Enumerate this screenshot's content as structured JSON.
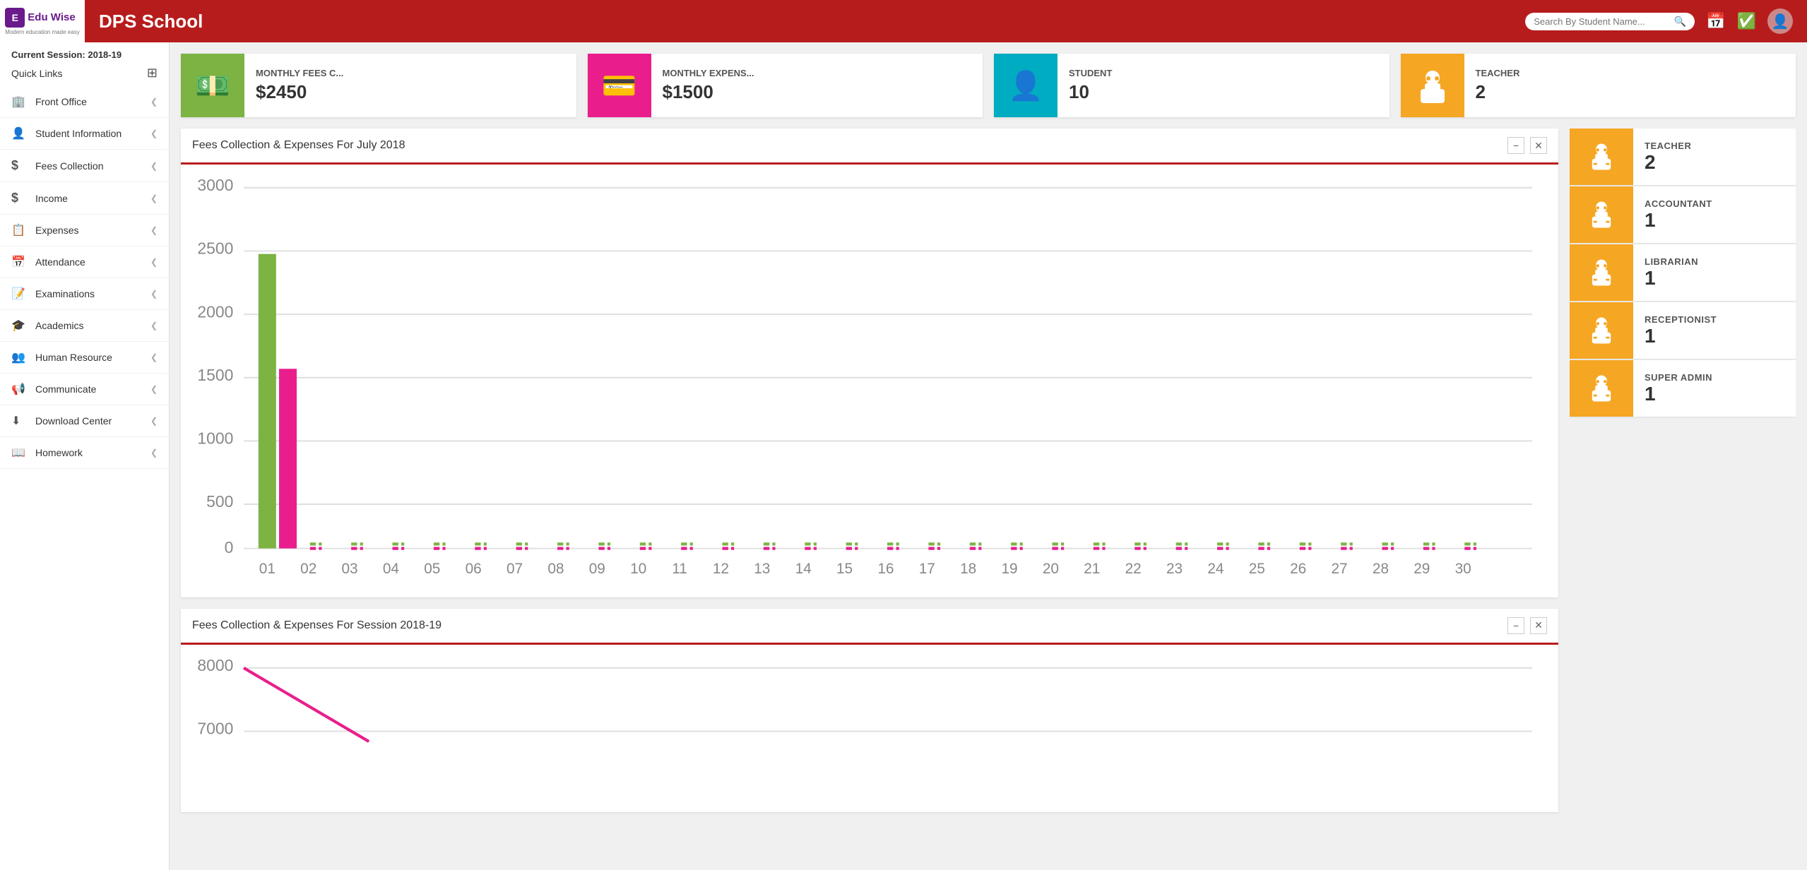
{
  "header": {
    "school_name": "DPS School",
    "search_placeholder": "Search By Student Name...",
    "logo_line1": "Edu Wise",
    "logo_line2": "Modern education made easy"
  },
  "sidebar": {
    "session": "Current Session: 2018-19",
    "quick_links_label": "Quick Links",
    "nav_items": [
      {
        "id": "front-office",
        "icon": "🏢",
        "label": "Front Office"
      },
      {
        "id": "student-information",
        "icon": "👤",
        "label": "Student Information"
      },
      {
        "id": "fees-collection",
        "icon": "$",
        "label": "Fees Collection"
      },
      {
        "id": "income",
        "icon": "$",
        "label": "Income"
      },
      {
        "id": "expenses",
        "icon": "📋",
        "label": "Expenses"
      },
      {
        "id": "attendance",
        "icon": "📅",
        "label": "Attendance"
      },
      {
        "id": "examinations",
        "icon": "📝",
        "label": "Examinations"
      },
      {
        "id": "academics",
        "icon": "🎓",
        "label": "Academics"
      },
      {
        "id": "human-resource",
        "icon": "👥",
        "label": "Human Resource"
      },
      {
        "id": "communicate",
        "icon": "📢",
        "label": "Communicate"
      },
      {
        "id": "download-center",
        "icon": "⬇",
        "label": "Download Center"
      },
      {
        "id": "homework",
        "icon": "📖",
        "label": "Homework"
      }
    ]
  },
  "stats": [
    {
      "id": "monthly-fees",
      "label": "MONTHLY FEES C...",
      "value": "$2450",
      "bg": "#7cb342",
      "icon": "💵"
    },
    {
      "id": "monthly-expenses",
      "label": "MONTHLY EXPENS...",
      "value": "$1500",
      "bg": "#e91e8c",
      "icon": "💳"
    },
    {
      "id": "student",
      "label": "STUDENT",
      "value": "10",
      "bg": "#00acc1",
      "icon": "👤"
    },
    {
      "id": "teacher",
      "label": "TEACHER",
      "value": "2",
      "bg": "#f5a623",
      "icon": "🕵"
    }
  ],
  "roles": [
    {
      "id": "teacher",
      "name": "TEACHER",
      "count": "2"
    },
    {
      "id": "accountant",
      "name": "ACCOUNTANT",
      "count": "1"
    },
    {
      "id": "librarian",
      "name": "LIBRARIAN",
      "count": "1"
    },
    {
      "id": "receptionist",
      "name": "RECEPTIONIST",
      "count": "1"
    },
    {
      "id": "super-admin",
      "name": "SUPER ADMIN",
      "count": "1"
    }
  ],
  "charts": [
    {
      "id": "july-chart",
      "title": "Fees Collection & Expenses For July 2018",
      "y_labels": [
        "3000",
        "2500",
        "2000",
        "1500",
        "1000",
        "500",
        "0"
      ],
      "x_labels": [
        "01",
        "02",
        "03",
        "04",
        "05",
        "06",
        "07",
        "08",
        "09",
        "10",
        "11",
        "12",
        "13",
        "14",
        "15",
        "16",
        "17",
        "18",
        "19",
        "20",
        "21",
        "22",
        "23",
        "24",
        "25",
        "26",
        "27",
        "28",
        "29",
        "30"
      ],
      "bar_data": [
        {
          "x": 0,
          "green": 2450,
          "red": 1500
        }
      ],
      "max": 3000
    },
    {
      "id": "session-chart",
      "title": "Fees Collection & Expenses For Session 2018-19",
      "y_labels": [
        "8000",
        "7000"
      ],
      "max": 8000
    }
  ]
}
